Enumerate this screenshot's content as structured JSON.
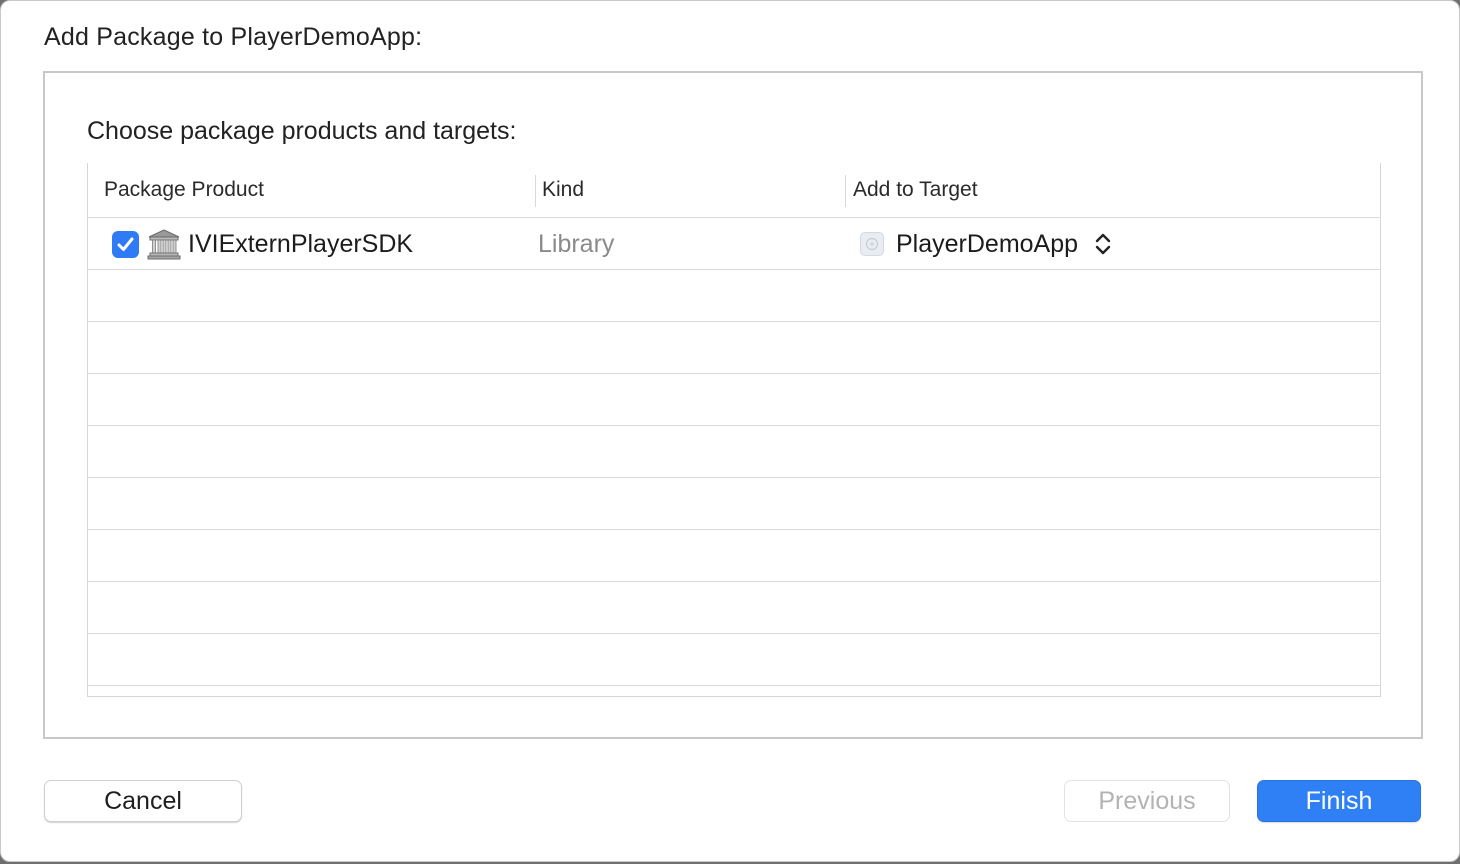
{
  "dialog": {
    "title": "Add Package to PlayerDemoApp:",
    "heading": "Choose package products and targets:"
  },
  "table": {
    "columns": [
      "Package Product",
      "Kind",
      "Add to Target"
    ],
    "rows": [
      {
        "checked": true,
        "icon": "package-library-icon",
        "product": "IVIExternPlayerSDK",
        "kind": "Library",
        "target_icon": "app-target-icon",
        "target": "PlayerDemoApp"
      }
    ]
  },
  "buttons": {
    "cancel": "Cancel",
    "previous": "Previous",
    "finish": "Finish"
  },
  "colors": {
    "accent": "#2f80f5",
    "checkbox": "#2f7bf6"
  }
}
